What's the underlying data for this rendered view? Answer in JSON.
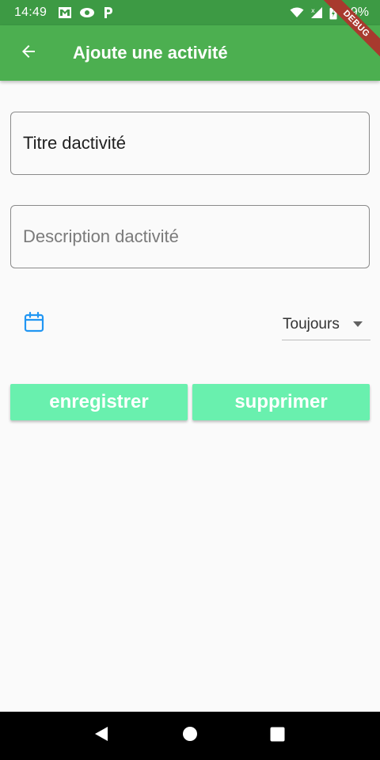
{
  "status_bar": {
    "time": "14:49",
    "battery_percent": "99%",
    "left_icons": [
      "gmail-icon",
      "cast-icon",
      "parking-icon"
    ],
    "right_icons": [
      "wifi-icon",
      "signal-icon",
      "battery-icon"
    ]
  },
  "debug_banner": "DEBUG",
  "app_bar": {
    "title": "Ajoute une activité",
    "back_icon": "arrow-back-icon",
    "color": "#4caf50"
  },
  "form": {
    "title_field_value": "Titre dactivité",
    "description_field_placeholder": "Description dactivité",
    "calendar_icon": "calendar-icon",
    "frequency_selected": "Toujours"
  },
  "actions": {
    "save_label": "enregistrer",
    "delete_label": "supprimer",
    "button_color": "#69f0ae"
  },
  "nav_bar": {
    "back": "nav-back-icon",
    "home": "nav-home-icon",
    "recents": "nav-recents-icon"
  }
}
